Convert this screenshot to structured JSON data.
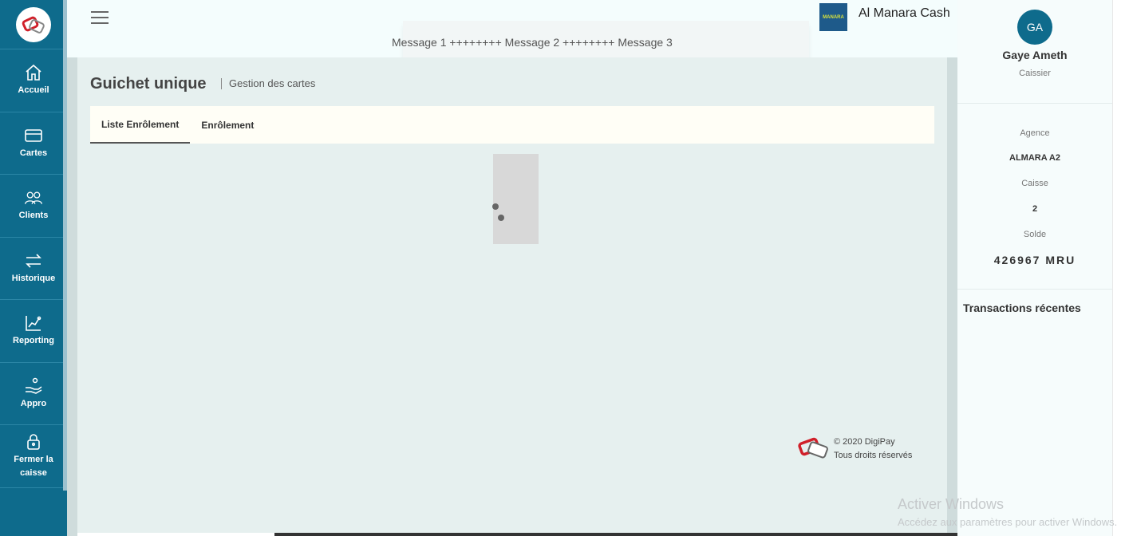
{
  "sidebar": {
    "items": [
      {
        "label": "Accueil",
        "icon": "home-icon"
      },
      {
        "label": "Cartes",
        "icon": "card-icon"
      },
      {
        "label": "Clients",
        "icon": "users-icon"
      },
      {
        "label": "Historique",
        "icon": "transfer-icon"
      },
      {
        "label": "Reporting",
        "icon": "chart-icon"
      },
      {
        "label": "Appro",
        "icon": "hand-coins-icon"
      },
      {
        "label": "Fermer la caisse",
        "icon": "lock-icon"
      }
    ]
  },
  "header": {
    "marquee": "Message 1 ++++++++ Message 2 ++++++++ Message 3",
    "brand_name": "Al Manara Cash"
  },
  "main": {
    "title": "Guichet unique",
    "subtitle": "Gestion des cartes",
    "tabs": [
      {
        "label": "Liste Enrôlement",
        "active": true
      },
      {
        "label": "Enrôlement",
        "active": false
      }
    ],
    "footer_copyright": "© 2020 DigiPay",
    "footer_rights": "Tous droits réservés"
  },
  "user": {
    "initials": "GA",
    "name": "Gaye Ameth",
    "role": "Caissier",
    "agency_label": "Agence",
    "agency_value": "ALMARA A2",
    "till_label": "Caisse",
    "till_value": "2",
    "balance_label": "Solde",
    "balance_value": "426967 MRU",
    "recent_tx_title": "Transactions récentes"
  },
  "windows": {
    "activate_title": "Activer Windows",
    "activate_sub": "Accédez aux paramètres pour activer Windows."
  },
  "colors": {
    "primary": "#0e6b8c",
    "content_bg": "#e6f0ef",
    "tabs_bg": "#fffef6"
  }
}
